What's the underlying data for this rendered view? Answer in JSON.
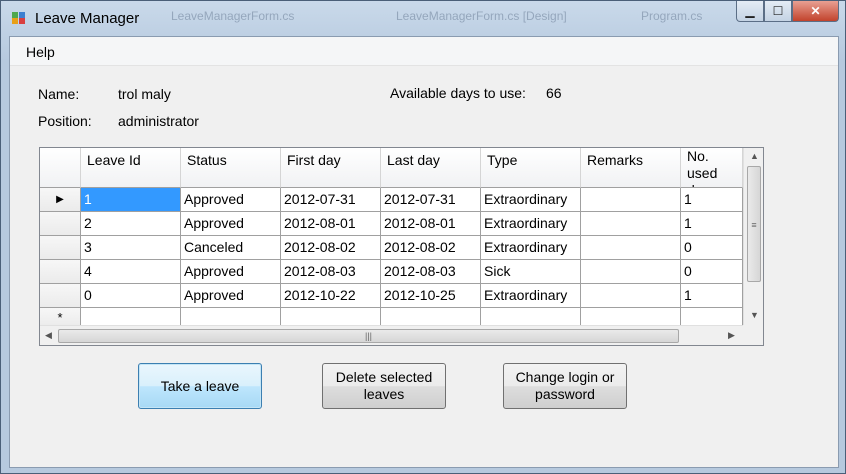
{
  "window": {
    "title": "Leave Manager",
    "ghost_titles": [
      "LeaveManagerForm.cs",
      "LeaveManagerForm.cs [Design]",
      "Program.cs"
    ]
  },
  "caption_buttons": {
    "minimize": "▁",
    "maximize": "☐",
    "close": "✕"
  },
  "menu": {
    "help": "Help"
  },
  "info": {
    "name_label": "Name:",
    "name_value": "trol maly",
    "position_label": "Position:",
    "position_value": "administrator",
    "available_label": "Available days to use:",
    "available_value": "66"
  },
  "grid": {
    "columns": [
      {
        "line1": "Leave Id",
        "line2": ""
      },
      {
        "line1": "Status",
        "line2": ""
      },
      {
        "line1": "First day",
        "line2": ""
      },
      {
        "line1": "Last day",
        "line2": ""
      },
      {
        "line1": "Type",
        "line2": ""
      },
      {
        "line1": "Remarks",
        "line2": ""
      },
      {
        "line1": "No. used",
        "line2": "days"
      }
    ],
    "rows": [
      [
        "1",
        "Approved",
        "2012-07-31",
        "2012-07-31",
        "Extraordinary",
        "",
        "1"
      ],
      [
        "2",
        "Approved",
        "2012-08-01",
        "2012-08-01",
        "Extraordinary",
        "",
        "1"
      ],
      [
        "3",
        "Canceled",
        "2012-08-02",
        "2012-08-02",
        "Extraordinary",
        "",
        "0"
      ],
      [
        "4",
        "Approved",
        "2012-08-03",
        "2012-08-03",
        "Sick",
        "",
        "0"
      ],
      [
        "0",
        "Approved",
        "2012-10-22",
        "2012-10-25",
        "Extraordinary",
        "",
        "1"
      ]
    ],
    "current_row_marker": "▶",
    "new_row_marker": "*"
  },
  "buttons": {
    "take_leave": "Take a leave",
    "delete_selected": "Delete selected leaves",
    "change_login": "Change login or password"
  }
}
